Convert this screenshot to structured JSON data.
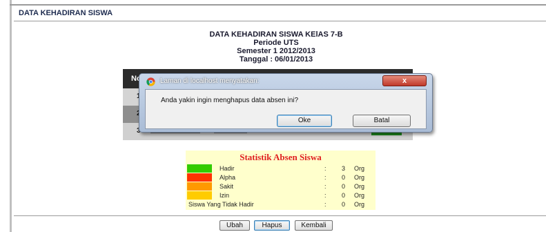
{
  "page": {
    "header": "DATA KEHADIRAN SISWA"
  },
  "report": {
    "line1": "DATA KEHADIRAN SISWA KElAS 7-B",
    "line2": "Periode UTS",
    "line3": "Semester 1 2012/2013",
    "line4": "Tanggal : 06/01/2013"
  },
  "table": {
    "header_no": "No",
    "rows": [
      "1",
      "2",
      "3"
    ]
  },
  "dialog": {
    "title": "Laman di localhost menyatakan:",
    "close_label": "x",
    "message": "Anda yakin ingin menghapus data absen ini?",
    "ok_label": "Oke",
    "cancel_label": "Batal"
  },
  "stats": {
    "title": "Statistik Absen Siswa",
    "rows": [
      {
        "label": "Hadir",
        "colon": ":",
        "value": "3",
        "unit": "Org",
        "color": "#33cc00"
      },
      {
        "label": "Alpha",
        "colon": ":",
        "value": "0",
        "unit": "Org",
        "color": "#ff3300"
      },
      {
        "label": "Sakit",
        "colon": ":",
        "value": "0",
        "unit": "Org",
        "color": "#ff9900"
      },
      {
        "label": "Izin",
        "colon": ":",
        "value": "0",
        "unit": "Org",
        "color": "#ffcc00"
      }
    ],
    "absent": {
      "label": "Siswa Yang Tidak Hadir",
      "colon": ":",
      "value": "0",
      "unit": "Org"
    }
  },
  "actions": {
    "edit_label": "Ubah",
    "delete_label": "Hapus",
    "back_label": "Kembali"
  },
  "icons": {
    "dialog_icon": "chrome-icon"
  }
}
